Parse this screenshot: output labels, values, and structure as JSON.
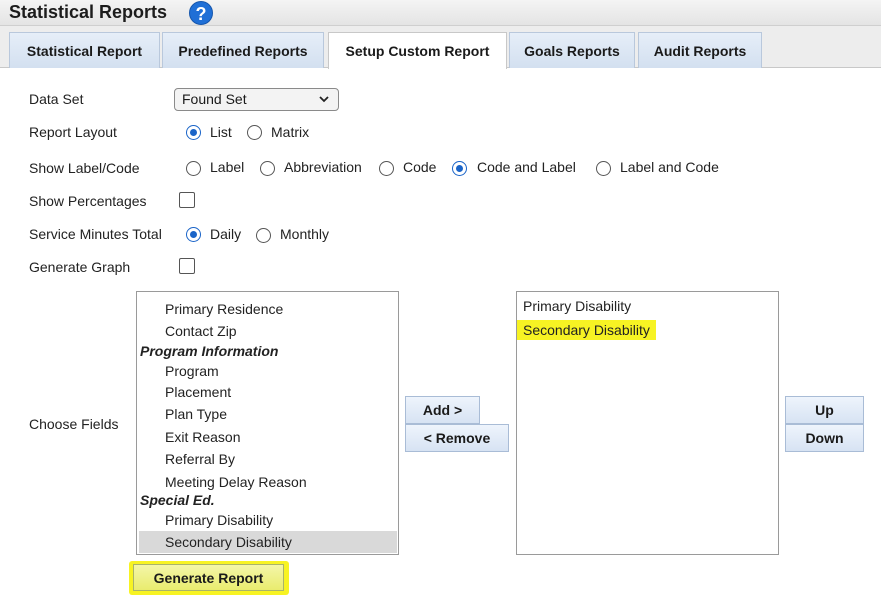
{
  "header": {
    "title": "Statistical Reports",
    "help_icon": "?"
  },
  "tabs": [
    {
      "label": "Statistical Report",
      "active": false
    },
    {
      "label": "Predefined Reports",
      "active": false
    },
    {
      "label": "Setup Custom Report",
      "active": true
    },
    {
      "label": "Goals Reports",
      "active": false
    },
    {
      "label": "Audit Reports",
      "active": false
    }
  ],
  "form": {
    "data_set": {
      "label": "Data Set",
      "value": "Found Set"
    },
    "report_layout": {
      "label": "Report Layout",
      "options": [
        "List",
        "Matrix"
      ],
      "selected": "List"
    },
    "show_label_code": {
      "label": "Show Label/Code",
      "options": [
        "Label",
        "Abbreviation",
        "Code",
        "Code and Label",
        "Label and Code"
      ],
      "selected": "Code and Label"
    },
    "show_percentages": {
      "label": "Show Percentages",
      "checked": false
    },
    "service_minutes_total": {
      "label": "Service Minutes Total",
      "options": [
        "Daily",
        "Monthly"
      ],
      "selected": "Daily"
    },
    "generate_graph": {
      "label": "Generate Graph",
      "checked": false
    },
    "choose_fields": {
      "label": "Choose Fields"
    }
  },
  "available_fields": [
    {
      "text": "Primary Residence",
      "group": false
    },
    {
      "text": "Contact Zip",
      "group": false
    },
    {
      "text": "Program Information",
      "group": true
    },
    {
      "text": "Program",
      "group": false
    },
    {
      "text": "Placement",
      "group": false
    },
    {
      "text": "Plan Type",
      "group": false
    },
    {
      "text": "Exit Reason",
      "group": false
    },
    {
      "text": "Referral By",
      "group": false
    },
    {
      "text": "Meeting Delay Reason",
      "group": false
    },
    {
      "text": "Special Ed.",
      "group": true
    },
    {
      "text": "Primary Disability",
      "group": false
    },
    {
      "text": "Secondary Disability",
      "group": false,
      "selected": true
    }
  ],
  "selected_fields": [
    {
      "text": "Primary Disability",
      "highlighted": false
    },
    {
      "text": "Secondary Disability",
      "highlighted": true
    }
  ],
  "buttons": {
    "add": "Add >",
    "remove": "< Remove",
    "up": "Up",
    "down": "Down",
    "generate": "Generate Report"
  },
  "colors": {
    "accent": "#1a64c8",
    "highlight": "#f7f323",
    "tab_bg": "#d3e0f0"
  }
}
